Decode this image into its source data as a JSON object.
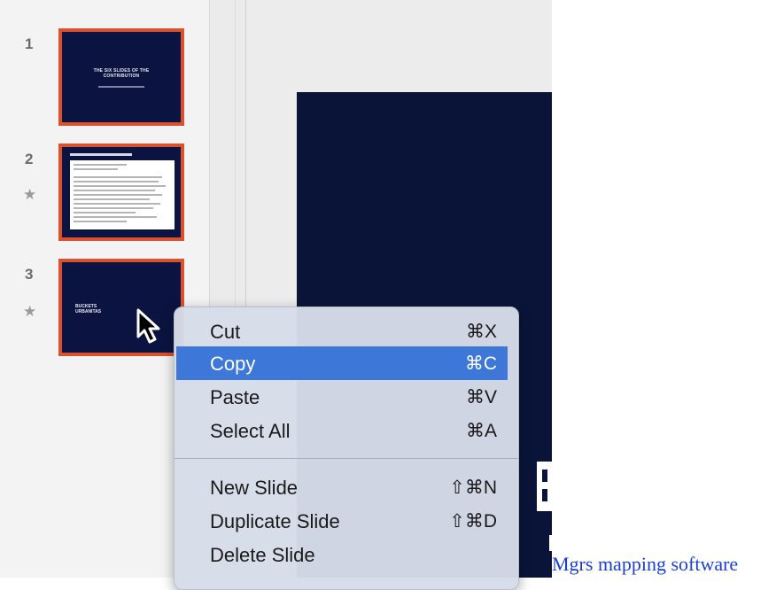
{
  "thumbnails": [
    {
      "number": "1",
      "title_text": "THE SIX SLIDES OF THE\nCONTRIBUTION"
    },
    {
      "number": "2",
      "starred": true
    },
    {
      "number": "3",
      "starred": true,
      "title_text": "BUCKETS\nURBANITAS"
    }
  ],
  "star_glyph": "★",
  "context_menu": {
    "items": [
      {
        "label": "Cut",
        "shortcut": "⌘X",
        "highlighted": false
      },
      {
        "label": "Copy",
        "shortcut": "⌘C",
        "highlighted": true
      },
      {
        "label": "Paste",
        "shortcut": "⌘V",
        "highlighted": false
      },
      {
        "label": "Select All",
        "shortcut": "⌘A",
        "highlighted": false
      },
      {
        "label": "New Slide",
        "shortcut": "⇧⌘N",
        "highlighted": false
      },
      {
        "label": "Duplicate Slide",
        "shortcut": "⇧⌘D",
        "highlighted": false
      },
      {
        "label": "Delete Slide",
        "shortcut": "",
        "highlighted": false
      }
    ]
  },
  "caption_link": "Mgrs mapping software",
  "colors": {
    "accent_border": "#d9512e",
    "slide_background": "#0a1438",
    "menu_highlight": "#3d78d8",
    "link": "#1a3fd8"
  }
}
